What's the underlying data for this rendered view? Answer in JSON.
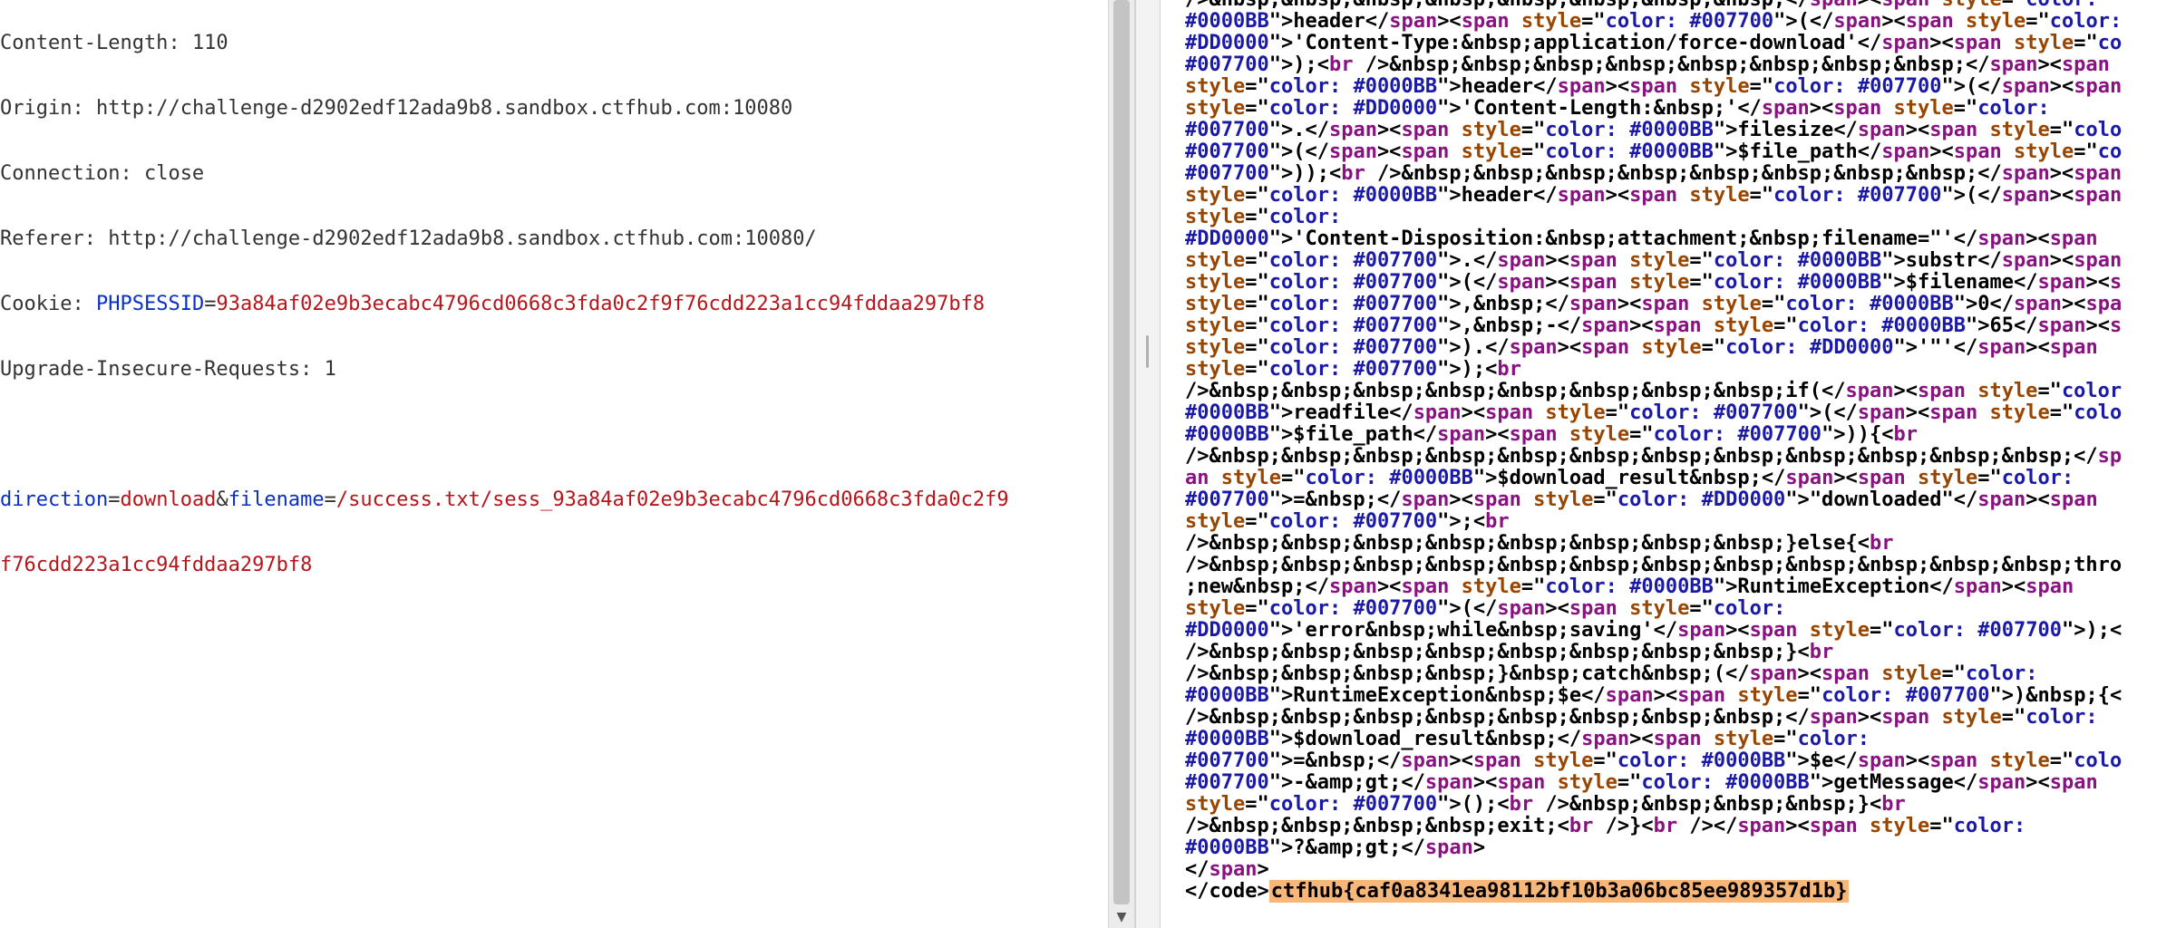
{
  "request": {
    "headers": [
      {
        "name": "Content-Length",
        "sep": ": ",
        "value": "110",
        "value_color": "plain"
      },
      {
        "name": "Origin",
        "sep": ": ",
        "value": "http://challenge-d2902edf12ada9b8.sandbox.ctfhub.com:10080",
        "value_color": "plain"
      },
      {
        "name": "Connection",
        "sep": ": ",
        "value": "close",
        "value_color": "plain"
      },
      {
        "name": "Referer",
        "sep": ": ",
        "value": "http://challenge-d2902edf12ada9b8.sandbox.ctfhub.com:10080/",
        "value_color": "plain"
      },
      {
        "name": "Cookie",
        "sep": ": ",
        "value": "",
        "value_color": "plain"
      },
      {
        "name": "Upgrade-Insecure-Requests",
        "sep": ": ",
        "value": "1",
        "value_color": "plain"
      }
    ],
    "cookie": {
      "key": "PHPSESSID",
      "eq": "=",
      "val": "93a84af02e9b3ecabc4796cd0668c3fda0c2f9f76cdd223a1cc94fddaa297bf8"
    },
    "body": {
      "line1": {
        "k1": "direction",
        "eq1": "=",
        "v1": "download",
        "amp": "&",
        "k2": "filename",
        "eq2": "=",
        "v2": "/success.txt/sess_93a84af02e9b3ecabc4796cd0668c3fda0c2f9"
      },
      "line2": "f76cdd223a1cc94fddaa297bf8"
    }
  },
  "response": {
    "flag": "ctfhub{caf0a8341ea98112bf10b3a06bc85ee989357d1b}",
    "close_code_tag": "</code>",
    "close_span_tag": "</span>"
  },
  "colors": {
    "blue": "#0a2fc8",
    "red": "#b5151b",
    "flag_highlight": "#f8b77a"
  },
  "icons": {
    "scroll_down": "triangle-down-icon"
  }
}
